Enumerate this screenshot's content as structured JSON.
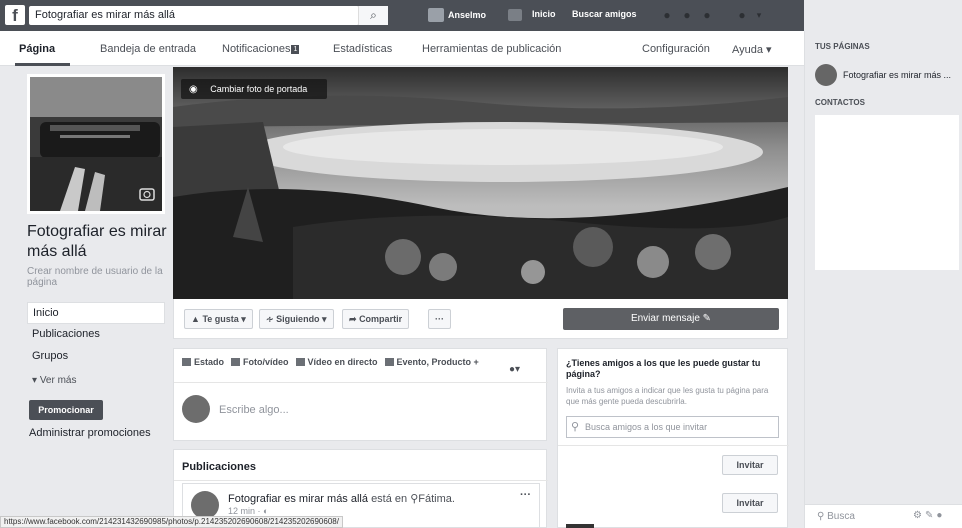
{
  "topbar": {
    "logo": "f",
    "search_value": "Fotografiar es mirar más allá",
    "user_name": "Anselmo",
    "home_label": "Inicio",
    "find_friends_label": "Buscar amigos"
  },
  "pagenav": {
    "items": [
      "Página",
      "Bandeja de entrada",
      "Notificaciones",
      "Estadísticas",
      "Herramientas de publicación",
      "Configuración",
      "Ayuda ▾"
    ],
    "notifications_count": "1"
  },
  "left": {
    "page_name": "Fotografiar es mirar más allá",
    "username_hint": "Crear nombre de usuario de la página",
    "nav": [
      "Inicio",
      "Publicaciones",
      "Grupos"
    ],
    "ver_mas": "Ver más",
    "promote_label": "Promocionar",
    "manage_promotions": "Administrar promociones"
  },
  "cover": {
    "change_cover_label": "Cambiar foto de portada"
  },
  "actions": {
    "like": "Te gusta ▾",
    "following": "Siguiendo ▾",
    "share": "Compartir",
    "more": "···",
    "send_message": "Enviar mensaje"
  },
  "composer": {
    "tabs": [
      "Estado",
      "Foto/vídeo",
      "Vídeo en directo",
      "Evento, Producto +"
    ],
    "placeholder": "Escribe algo..."
  },
  "publications": {
    "title": "Publicaciones",
    "post_author": "Fotografiar es mirar más allá",
    "post_location_prefix": "está en",
    "post_location": "Fátima.",
    "post_time": "12 min · ◐",
    "post_menu": "···"
  },
  "invite": {
    "title": "¿Tienes amigos a los que les puede gustar tu página?",
    "description": "Invita a tus amigos a indicar que les gusta tu página para que más gente pueda descubrirla.",
    "search_placeholder": "Busca amigos a los que invitar",
    "invite_label": "Invitar"
  },
  "right_sidebar": {
    "your_pages_heading": "TUS PÁGINAS",
    "page_name": "Fotografiar es mirar más ...",
    "contacts_heading": "CONTACTOS",
    "search_label": "Busca"
  },
  "statusbar": {
    "url": "https://www.facebook.com/214231432690985/photos/p.214235202690608/214235202690608/"
  }
}
